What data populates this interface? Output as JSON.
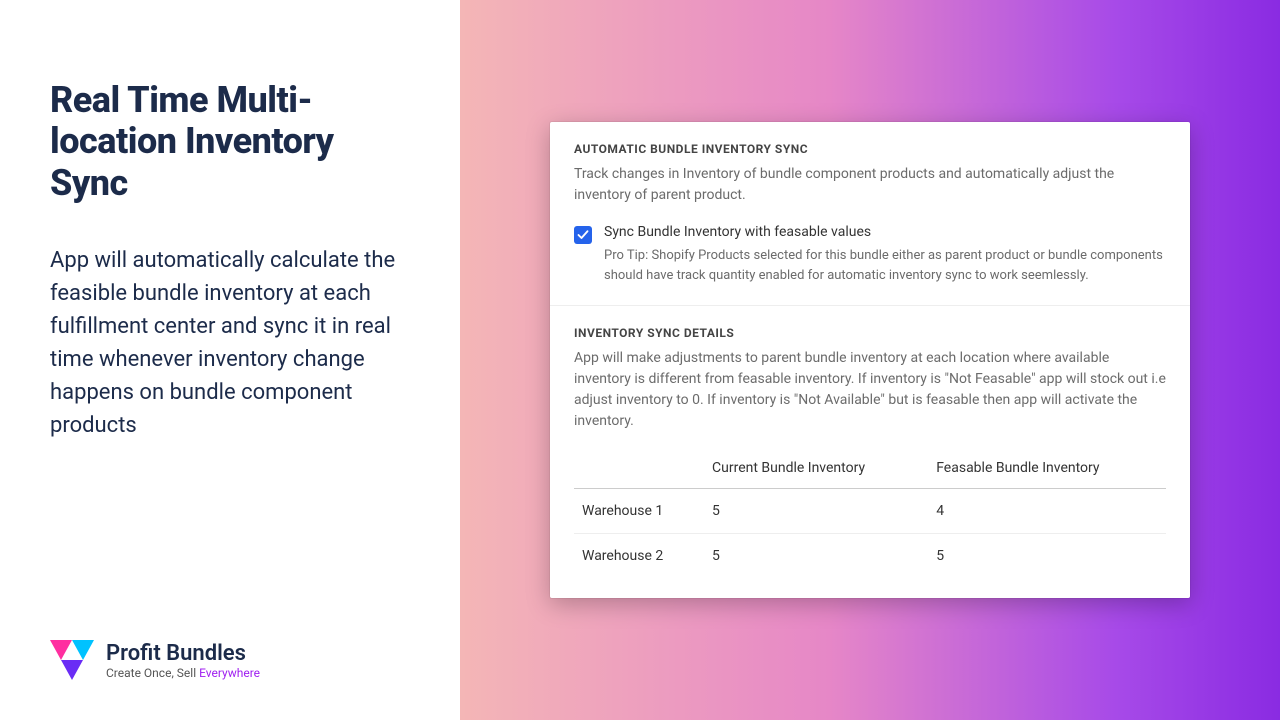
{
  "left": {
    "headline": "Real Time Multi-location Inventory Sync",
    "description": "App will automatically calculate the feasible bundle inventory at each fulfillment center and sync it in real time whenever inventory change happens on bundle component products"
  },
  "brand": {
    "name": "Profit Bundles",
    "tagline_prefix": "Create Once, Sell ",
    "tagline_accent": "Everywhere"
  },
  "card": {
    "autoSync": {
      "title": "AUTOMATIC BUNDLE INVENTORY SYNC",
      "desc": "Track changes in Inventory of bundle component products and automatically adjust the inventory of parent product.",
      "checkbox_label": "Sync Bundle Inventory with feasable values",
      "checkbox_checked": true,
      "hint": "Pro Tip: Shopify Products selected for this bundle either as parent product or bundle components should have track quantity enabled for automatic inventory sync to work seemlessly."
    },
    "details": {
      "title": "INVENTORY SYNC DETAILS",
      "desc": "App will make adjustments to parent bundle inventory at each location where available inventory is different from feasable inventory. If inventory is \"Not Feasable\" app will stock out i.e adjust inventory to 0. If inventory is \"Not Available\" but is feasable then app will activate the inventory.",
      "columns": [
        "",
        "Current Bundle Inventory",
        "Feasable Bundle Inventory"
      ],
      "rows": [
        {
          "loc": "Warehouse 1",
          "current": "5",
          "feasable": "4"
        },
        {
          "loc": "Warehouse 2",
          "current": "5",
          "feasable": "5"
        }
      ]
    }
  }
}
